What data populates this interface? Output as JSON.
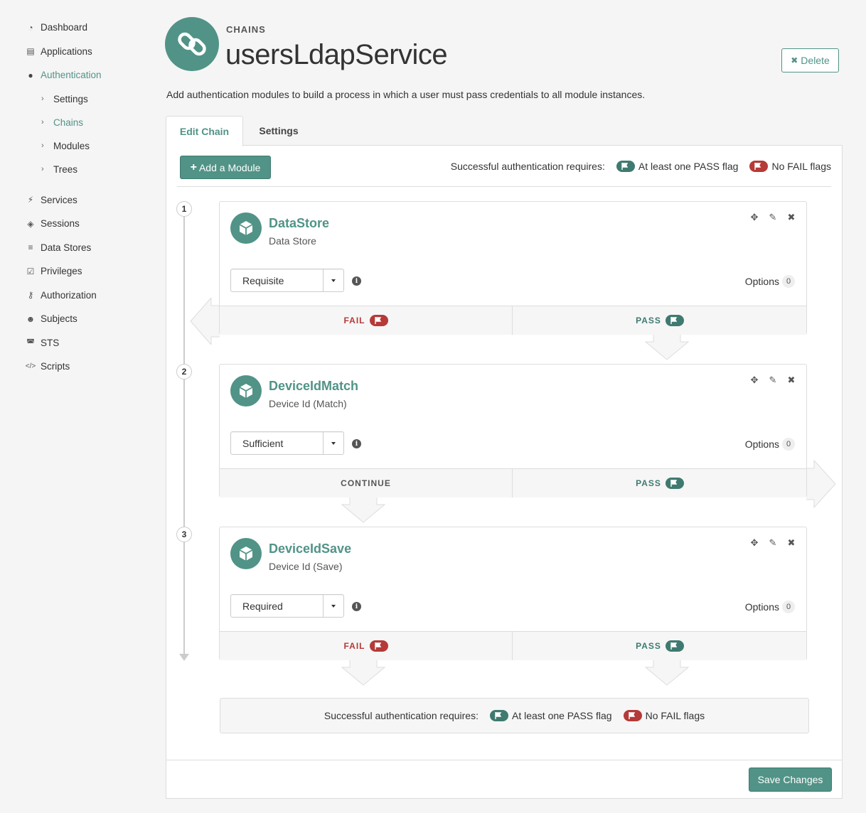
{
  "sidebar": {
    "items": [
      {
        "label": "Dashboard",
        "icon": "dashboard-icon"
      },
      {
        "label": "Applications",
        "icon": "list-icon"
      },
      {
        "label": "Authentication",
        "icon": "user-icon"
      },
      {
        "label": "Services",
        "icon": "plug-icon"
      },
      {
        "label": "Sessions",
        "icon": "ticket-icon"
      },
      {
        "label": "Data Stores",
        "icon": "database-icon"
      },
      {
        "label": "Privileges",
        "icon": "check-square-icon"
      },
      {
        "label": "Authorization",
        "icon": "key-icon"
      },
      {
        "label": "Subjects",
        "icon": "users-icon"
      },
      {
        "label": "STS",
        "icon": "mask-icon"
      },
      {
        "label": "Scripts",
        "icon": "code-icon"
      }
    ],
    "auth_sub": [
      {
        "label": "Settings"
      },
      {
        "label": "Chains"
      },
      {
        "label": "Modules"
      },
      {
        "label": "Trees"
      }
    ]
  },
  "header": {
    "kicker": "CHAINS",
    "title": "usersLdapService",
    "delete_label": "Delete",
    "description": "Add authentication modules to build a process in which a user must pass credentials to all module instances."
  },
  "tabs": [
    {
      "label": "Edit Chain"
    },
    {
      "label": "Settings"
    }
  ],
  "toolbar": {
    "add_label": "Add a Module",
    "requires_label": "Successful authentication requires:",
    "pass_flag_label": "At least one PASS flag",
    "fail_flag_label": "No FAIL flags"
  },
  "modules": [
    {
      "number": "1",
      "name": "DataStore",
      "type": "Data Store",
      "criteria": "Requisite",
      "options_label": "Options",
      "options_count": "0",
      "left_label": "FAIL",
      "right_label": "PASS"
    },
    {
      "number": "2",
      "name": "DeviceIdMatch",
      "type": "Device Id (Match)",
      "criteria": "Sufficient",
      "options_label": "Options",
      "options_count": "0",
      "left_label": "CONTINUE",
      "right_label": "PASS"
    },
    {
      "number": "3",
      "name": "DeviceIdSave",
      "type": "Device Id (Save)",
      "criteria": "Required",
      "options_label": "Options",
      "options_count": "0",
      "left_label": "FAIL",
      "right_label": "PASS"
    }
  ],
  "footer": {
    "save_label": "Save Changes"
  },
  "colors": {
    "accent": "#519387",
    "pass": "#3f7a70",
    "fail": "#b53a38"
  }
}
